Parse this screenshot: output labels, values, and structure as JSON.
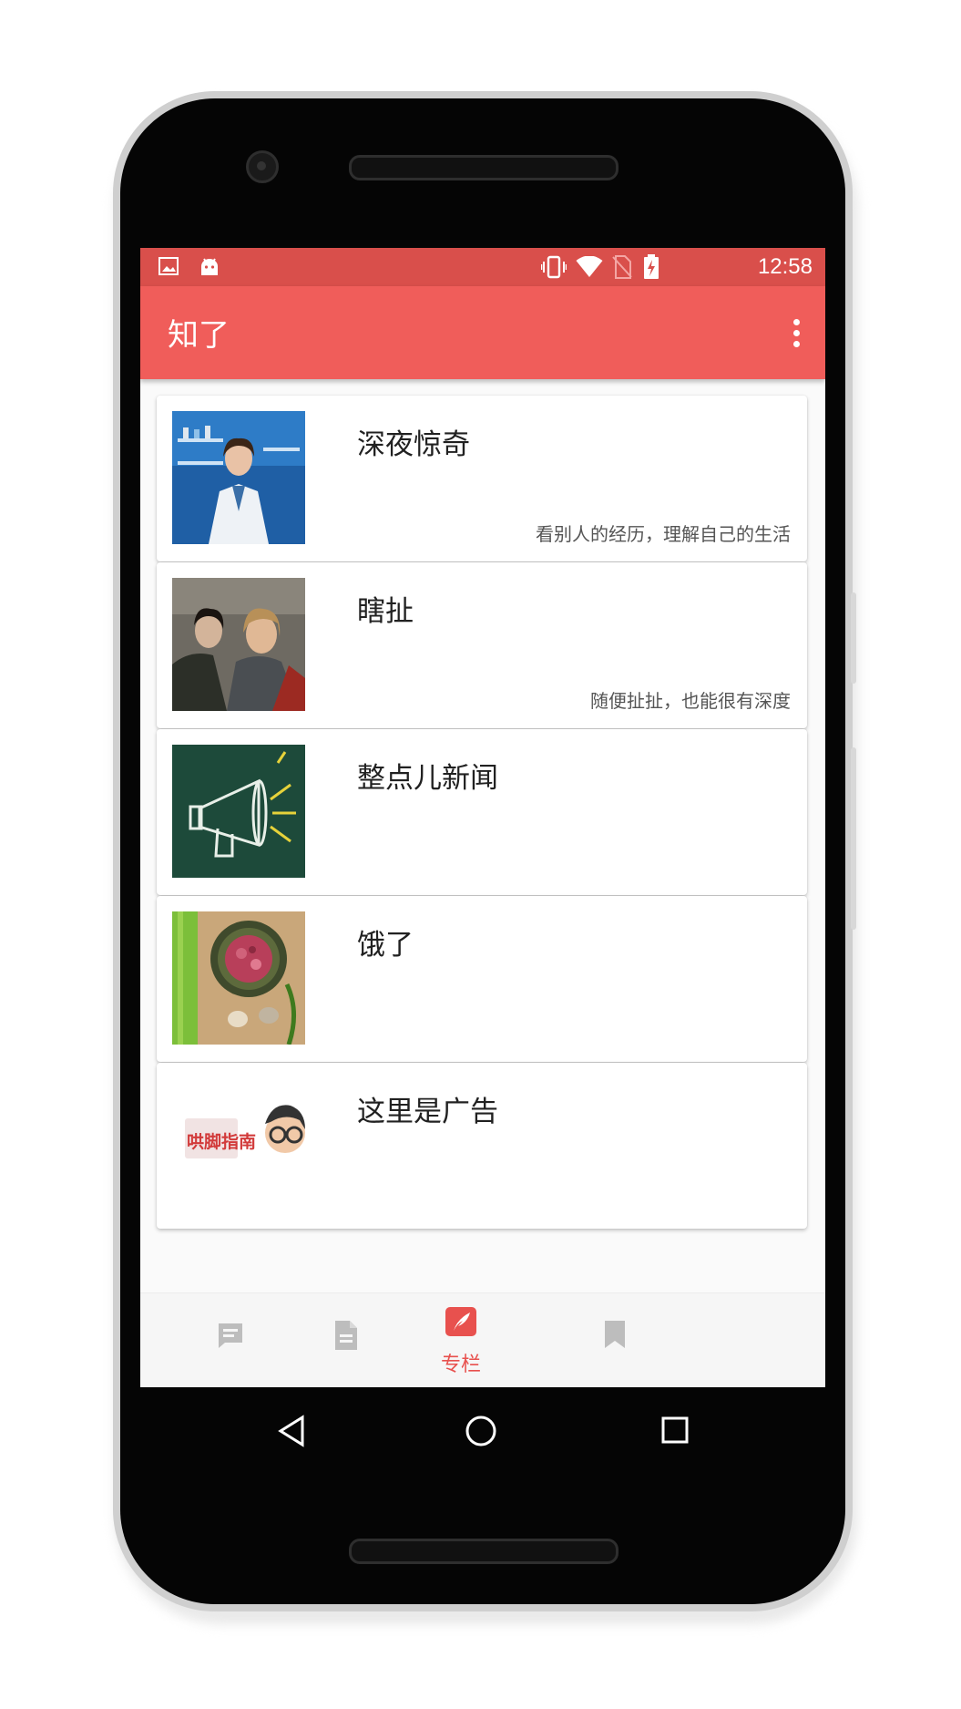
{
  "status_bar": {
    "time": "12:58",
    "left_icons": [
      "image-icon",
      "android-icon"
    ],
    "right_icons": [
      "vibrate-icon",
      "wifi-icon",
      "no-sim-icon",
      "battery-charging-icon"
    ]
  },
  "app_bar": {
    "title": "知了",
    "menu_icon": "overflow-menu-icon"
  },
  "columns": [
    {
      "title": "深夜惊奇",
      "subtitle": "看别人的经历，理解自己的生活"
    },
    {
      "title": "瞎扯",
      "subtitle": "随便扯扯，也能很有深度"
    },
    {
      "title": "整点儿新闻",
      "subtitle": ""
    },
    {
      "title": "饿了",
      "subtitle": ""
    },
    {
      "title": "这里是广告",
      "subtitle": "",
      "thumb_text": "哄脚指南"
    }
  ],
  "bottom_nav": [
    {
      "icon": "chat-icon",
      "label": "",
      "active": false
    },
    {
      "icon": "document-icon",
      "label": "",
      "active": false
    },
    {
      "icon": "quill-icon",
      "label": "专栏",
      "active": true
    },
    {
      "icon": "bookmark-icon",
      "label": "",
      "active": false
    }
  ],
  "colors": {
    "status_bar": "#d94f4b",
    "app_bar": "#f05d5a",
    "accent": "#e8514e",
    "inactive_icon": "#bdbdbd"
  }
}
